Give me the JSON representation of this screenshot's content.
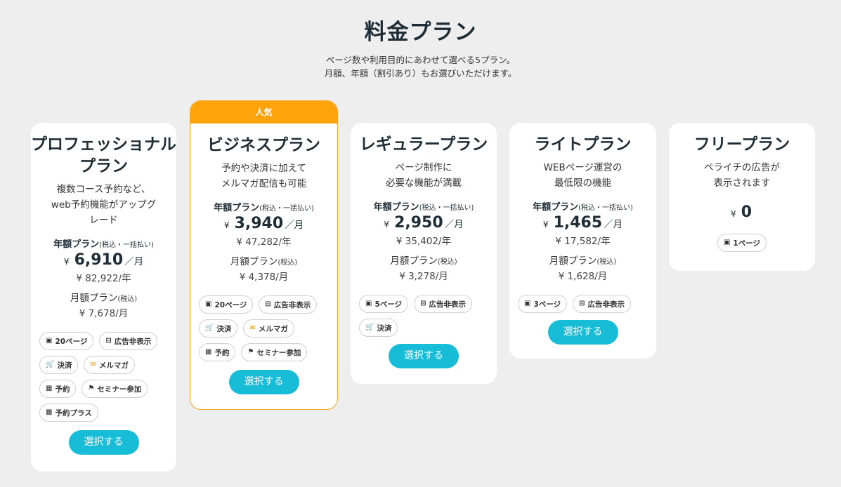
{
  "header": {
    "title": "料金プラン",
    "subtitle_line1": "ページ数や利用目的にあわせて選べる5プラン。",
    "subtitle_line2": "月額、年額（割引あり）もお選びいただけます。"
  },
  "common": {
    "yen": "¥",
    "per_month": "／月",
    "yearly_label": "年額プラン",
    "yearly_tax": "(税込・一括払い)",
    "monthly_label": "月額プラン",
    "monthly_tax": "(税込)",
    "select_label": "選択する",
    "popular_label": "人気"
  },
  "plans": [
    {
      "name_line1": "プロフェッショナル",
      "name_line2": "プラン",
      "desc_line1": "複数コース予約など、",
      "desc_line2": "web予約機能がアップグ",
      "desc_line3": "レード",
      "yearly_price": "6,910",
      "yearly_total": "¥ 82,922/年",
      "monthly_price": "¥ 7,678/月",
      "features": [
        "20ページ",
        "広告非表示",
        "決済",
        "メルマガ",
        "予約",
        "セミナー参加",
        "予約プラス"
      ]
    },
    {
      "name_line1": "ビジネスプラン",
      "desc_line1": "予約や決済に加えて",
      "desc_line2": "メルマガ配信も可能",
      "yearly_price": "3,940",
      "yearly_total": "¥ 47,282/年",
      "monthly_price": "¥ 4,378/月",
      "features": [
        "20ページ",
        "広告非表示",
        "決済",
        "メルマガ",
        "予約",
        "セミナー参加"
      ]
    },
    {
      "name_line1": "レギュラープラン",
      "desc_line1": "ページ制作に",
      "desc_line2": "必要な機能が満載",
      "yearly_price": "2,950",
      "yearly_total": "¥ 35,402/年",
      "monthly_price": "¥ 3,278/月",
      "features": [
        "5ページ",
        "広告非表示",
        "決済"
      ]
    },
    {
      "name_line1": "ライトプラン",
      "desc_line1": "WEBページ運営の",
      "desc_line2": "最低限の機能",
      "yearly_price": "1,465",
      "yearly_total": "¥ 17,582/年",
      "monthly_price": "¥ 1,628/月",
      "features": [
        "3ページ",
        "広告非表示"
      ]
    },
    {
      "name_line1": "フリープラン",
      "desc_line1": "ペライチの広告が",
      "desc_line2": "表示されます",
      "price": "0",
      "features": [
        "1ページ"
      ]
    }
  ],
  "icons": {
    "pages": "page-icon",
    "no_ads": "no-ads-icon",
    "payment": "cart-icon",
    "mail": "mail-icon",
    "reservation": "calendar-icon",
    "seminar": "seminar-icon"
  },
  "colors": {
    "accent": "#17bdd6",
    "popular": "#ffa30d",
    "background": "#eeeeee"
  }
}
